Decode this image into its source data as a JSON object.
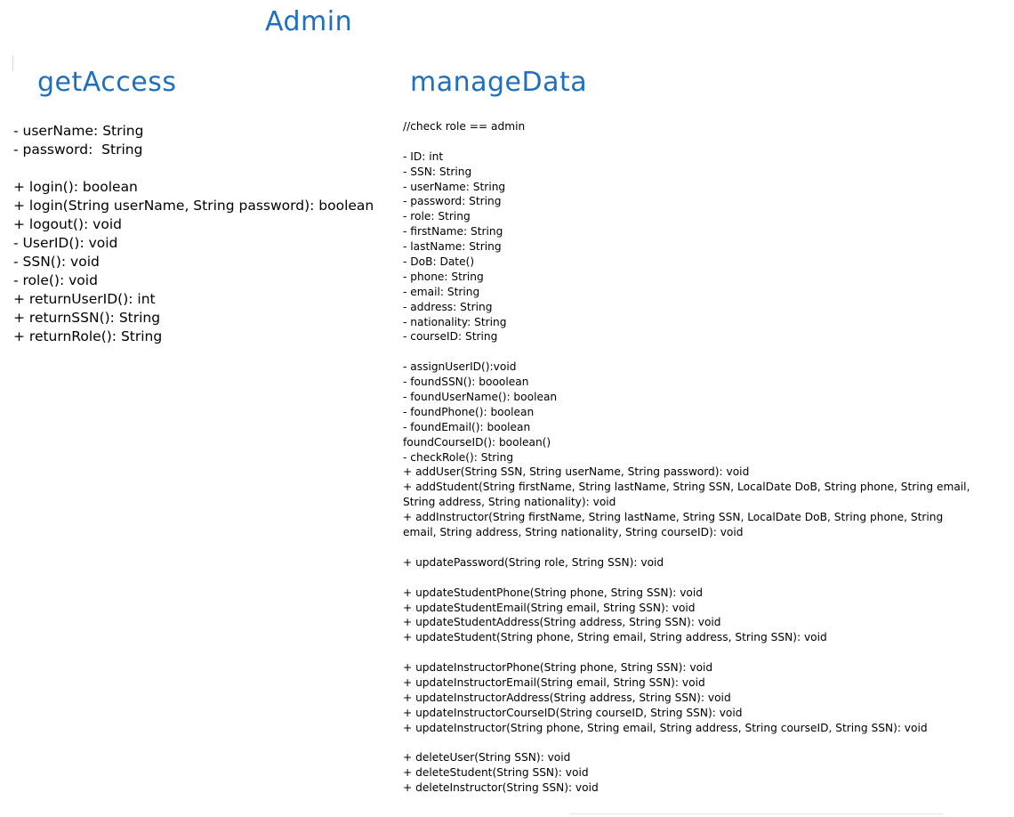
{
  "diagram": {
    "class_name": "Admin",
    "get_access": {
      "title": "getAccess",
      "lines": [
        "- userName: String",
        "- password:  String",
        "",
        "+ login(): boolean",
        "+ login(String userName, String password): boolean",
        "+ logout(): void",
        "- UserID(): void",
        "- SSN(): void",
        "- role(): void",
        "+ returnUserID(): int",
        "+ returnSSN(): String",
        "+ returnRole(): String"
      ]
    },
    "manage_data": {
      "title": "manageData",
      "lines": [
        "//check role == admin",
        "",
        "- ID: int",
        "- SSN: String",
        "- userName: String",
        "- password: String",
        "- role: String",
        "- firstName: String",
        "- lastName: String",
        "- DoB: Date()",
        "- phone: String",
        "- email: String",
        "- address: String",
        "- nationality: String",
        "- courseID: String",
        "",
        "- assignUserID():void",
        "- foundSSN(): booolean",
        "- foundUserName(): boolean",
        "- foundPhone(): boolean",
        "- foundEmail(): boolean",
        "foundCourseID(): boolean()",
        "- checkRole(): String",
        "+ addUser(String SSN, String userName, String password): void",
        "+ addStudent(String firstName, String lastName, String SSN, LocalDate DoB, String phone, String email,",
        "String address, String nationality): void",
        "+ addInstructor(String firstName, String lastName, String SSN, LocalDate DoB, String phone, String",
        "email, String address, String nationality, String courseID): void",
        "",
        "+ updatePassword(String role, String SSN): void",
        "",
        "+ updateStudentPhone(String phone, String SSN): void",
        "+ updateStudentEmail(String email, String SSN): void",
        "+ updateStudentAddress(String address, String SSN): void",
        "+ updateStudent(String phone, String email, String address, String SSN): void",
        "",
        "+ updateInstructorPhone(String phone, String SSN): void",
        "+ updateInstructorEmail(String email, String SSN): void",
        "+ updateInstructorAddress(String address, String SSN): void",
        "+ updateInstructorCourseID(String courseID, String SSN): void",
        "+ updateInstructor(String phone, String email, String address, String courseID, String SSN): void",
        "",
        "+ deleteUser(String SSN): void",
        "+ deleteStudent(String SSN): void",
        "+ deleteInstructor(String SSN): void"
      ]
    }
  },
  "colors": {
    "title": "#1f6fbf",
    "text": "#000000",
    "background": "#ffffff"
  }
}
